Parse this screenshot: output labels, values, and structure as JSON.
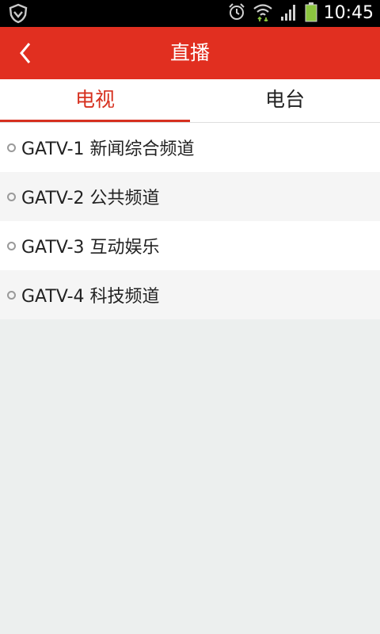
{
  "status_bar": {
    "time": "10:45",
    "icons": [
      "shield-icon",
      "alarm-icon",
      "wifi-icon",
      "signal-icon",
      "battery-icon"
    ],
    "colors": {
      "battery": "#8bc53f",
      "wifi_arrows": "#8bc53f"
    }
  },
  "header": {
    "title": "直播",
    "back_icon": "chevron-left-icon",
    "background": "#e12f20"
  },
  "tabs": [
    {
      "label": "电视",
      "active": true
    },
    {
      "label": "电台",
      "active": false
    }
  ],
  "accent_color": "#d6301f",
  "channels": [
    {
      "label": "GATV-1 新闻综合频道"
    },
    {
      "label": "GATV-2 公共频道"
    },
    {
      "label": "GATV-3 互动娱乐"
    },
    {
      "label": "GATV-4 科技频道"
    }
  ]
}
